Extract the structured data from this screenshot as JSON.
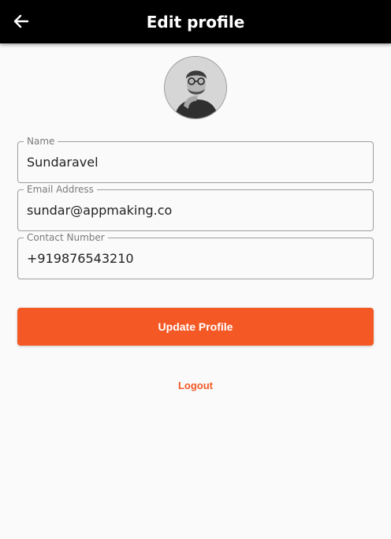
{
  "appbar": {
    "title": "Edit profile",
    "back_icon": "arrow-left-icon"
  },
  "profile": {
    "avatar_icon": "profile-photo"
  },
  "form": {
    "name": {
      "label": "Name",
      "value": "Sundaravel"
    },
    "email": {
      "label": "Email Address",
      "value": "sundar@appmaking.co"
    },
    "contact": {
      "label": "Contact Number",
      "value": "+919876543210"
    }
  },
  "actions": {
    "update_label": "Update Profile",
    "logout_label": "Logout"
  },
  "colors": {
    "appbar": "#000000",
    "accent": "#f45925",
    "background": "#fafafa"
  }
}
